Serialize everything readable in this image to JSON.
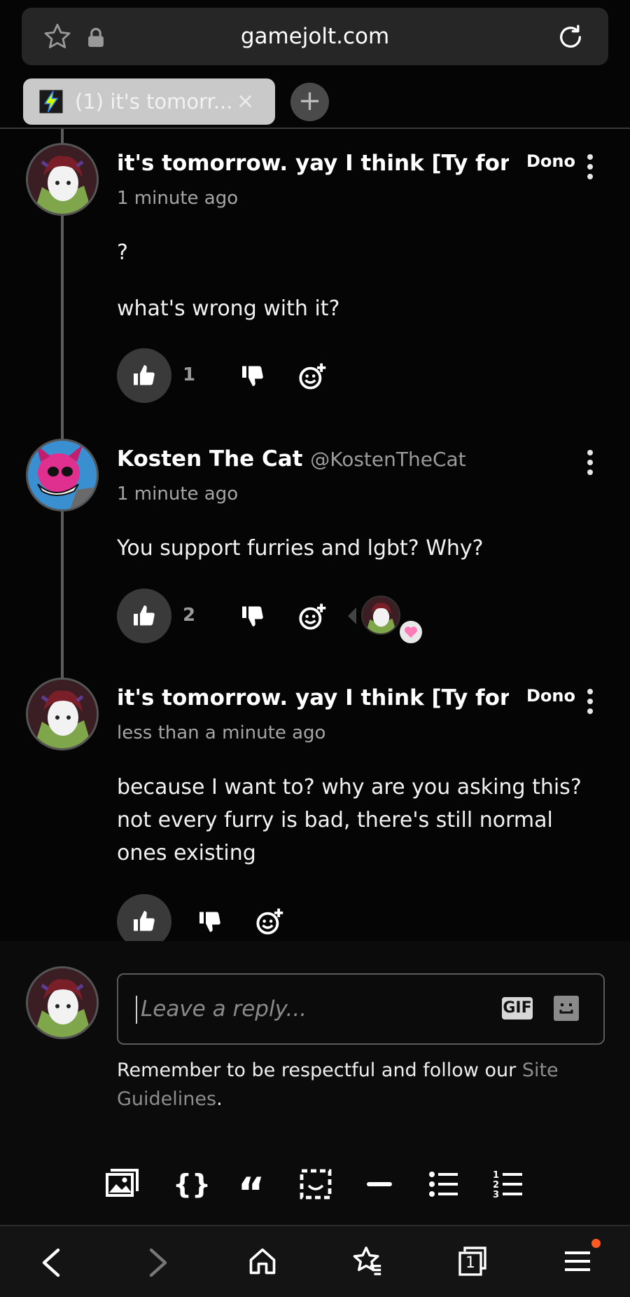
{
  "browser": {
    "url": "gamejolt.com",
    "tab_title": "(1) it's tomorr...",
    "tab_close": "×",
    "new_tab": "+"
  },
  "comments": [
    {
      "author": "it's tomorrow. yay I think [Ty for e...",
      "badge": "Dono",
      "time": "1 minute ago",
      "lines": [
        "?",
        "what's wrong with it?"
      ],
      "likes": "1"
    },
    {
      "author": "Kosten The Cat",
      "handle": "@KostenTheCat",
      "time": "1 minute ago",
      "lines": [
        "You support furries and lgbt? Why?"
      ],
      "likes": "2"
    },
    {
      "author": "it's tomorrow. yay I think [Ty for e...",
      "badge": "Dono",
      "time": "less than a minute ago",
      "lines": [
        "because I want to? why are you asking this? not every furry is bad, there's still normal ones existing"
      ]
    }
  ],
  "reply": {
    "placeholder": "Leave a reply...",
    "gif_label": "GIF",
    "guidelines_prefix": "Remember to be respectful and follow our ",
    "guidelines_link": "Site Guidelines",
    "guidelines_suffix": "."
  },
  "toolbar": [
    "image-icon",
    "code-icon",
    "quote-icon",
    "spoiler-icon",
    "hr-icon",
    "bullet-list-icon",
    "numbered-list-icon"
  ],
  "bottom_nav": {
    "tab_count": "1",
    "notification_color": "#ff5a1f"
  },
  "colors": {
    "background": "#050505",
    "like_heart": "#ff7ab8"
  }
}
